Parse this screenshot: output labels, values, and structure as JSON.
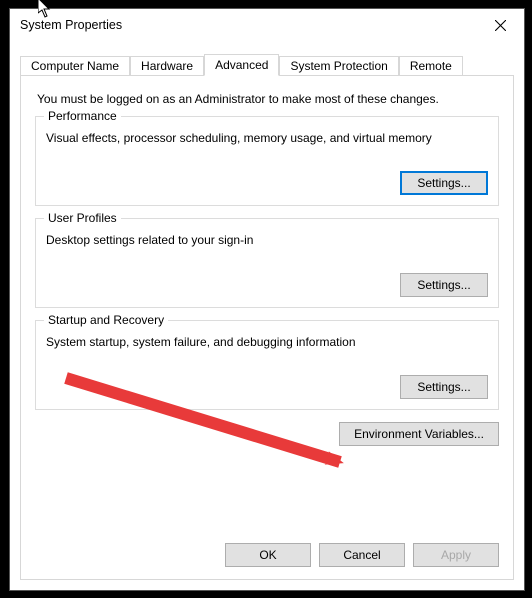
{
  "window": {
    "title": "System Properties"
  },
  "tabs": {
    "t0": "Computer Name",
    "t1": "Hardware",
    "t2": "Advanced",
    "t3": "System Protection",
    "t4": "Remote",
    "active": "Advanced"
  },
  "advanced": {
    "intro": "You must be logged on as an Administrator to make most of these changes.",
    "performance": {
      "legend": "Performance",
      "desc": "Visual effects, processor scheduling, memory usage, and virtual memory",
      "button": "Settings..."
    },
    "userProfiles": {
      "legend": "User Profiles",
      "desc": "Desktop settings related to your sign-in",
      "button": "Settings..."
    },
    "startupRecovery": {
      "legend": "Startup and Recovery",
      "desc": "System startup, system failure, and debugging information",
      "button": "Settings..."
    },
    "envVars": {
      "button": "Environment Variables..."
    }
  },
  "dialogButtons": {
    "ok": "OK",
    "cancel": "Cancel",
    "apply": "Apply"
  },
  "annotation": {
    "arrow_color": "#e83a3a"
  }
}
